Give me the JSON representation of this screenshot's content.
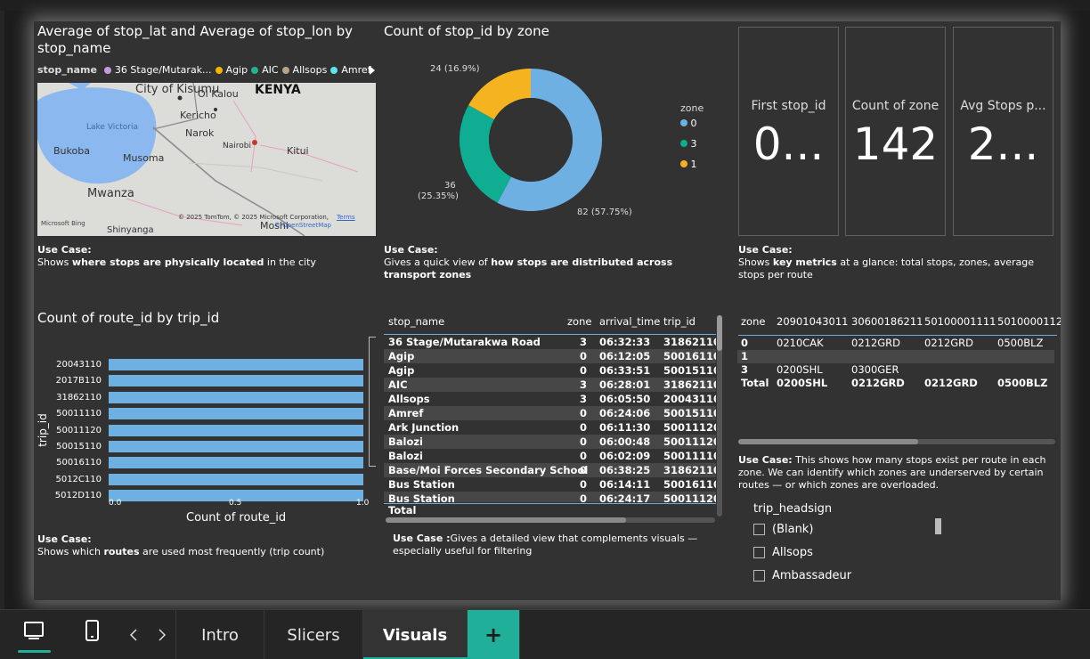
{
  "map_visual": {
    "title": "Average of stop_lat and Average of stop_lon by stop_name",
    "legend_label": "stop_name",
    "legend_items": [
      {
        "label": "36 Stage/Mutarak...",
        "color": "#c49bdc"
      },
      {
        "label": "Agip",
        "color": "#f5b400"
      },
      {
        "label": "AIC",
        "color": "#20b38f"
      },
      {
        "label": "Allsops",
        "color": "#b7a38a"
      },
      {
        "label": "Amref",
        "color": "#5ee6f0"
      }
    ],
    "places": [
      "City of Kisumu",
      "Ol Kalou",
      "KENYA",
      "Kericho",
      "Lake Victoria",
      "Narok",
      "Nairobi",
      "Kitui",
      "Bukoba",
      "Musoma",
      "Mwanza",
      "Shinyanga",
      "Moshi"
    ],
    "attribution": "© 2025 TomTom, © 2025 Microsoft Corporation,",
    "terms": "Terms",
    "osm": "© OpenStreetMap",
    "bing": "Microsoft Bing",
    "use_case_label": "Use Case:",
    "use_case_pre": "Shows ",
    "use_case_bold": "where stops are physically located",
    "use_case_post": " in the city"
  },
  "donut_visual": {
    "title": "Count of stop_id by zone",
    "use_case_label": "Use Case:",
    "use_case_pre": "Gives a quick view of ",
    "use_case_bold": "how stops are distributed across transport zones",
    "slice_labels": {
      "s0": "82 (57.75%)",
      "s3_count": "36",
      "s3_pct": "(25.35%)",
      "s1": "24 (16.9%)"
    }
  },
  "chart_data": [
    {
      "type": "pie",
      "title": "Count of stop_id by zone",
      "legend_title": "zone",
      "legend_position": "right",
      "categories": [
        "0",
        "3",
        "1"
      ],
      "values": [
        82,
        36,
        24
      ],
      "percentages": [
        57.75,
        25.35,
        16.9
      ],
      "colors": [
        "#6fb0e3",
        "#0fad91",
        "#f5b41f"
      ]
    },
    {
      "type": "bar",
      "orientation": "horizontal",
      "title": "Count of route_id by trip_id",
      "xlabel": "Count of route_id",
      "ylabel": "trip_id",
      "categories": [
        "20043110",
        "2017B110",
        "31862110",
        "50011110",
        "50011120",
        "50015110",
        "50016110",
        "5012C110",
        "5012D110"
      ],
      "values": [
        1,
        1,
        1,
        1,
        1,
        1,
        1,
        1,
        1
      ],
      "xlim": [
        0,
        1
      ],
      "xticks": [
        "0.0",
        "0.5",
        "1.0"
      ],
      "color": "#6fb0e3"
    }
  ],
  "bar_visual": {
    "use_case_label": "Use Case:",
    "use_case_pre": "Shows which ",
    "use_case_bold": "routes",
    "use_case_post": " are used most frequently (trip count)"
  },
  "cards": [
    {
      "title": "First stop_id",
      "value": "0..."
    },
    {
      "title": "Count of zone",
      "value": "142"
    },
    {
      "title": "Avg Stops p...",
      "value": "2..."
    }
  ],
  "cards_use_case": {
    "label": "Use Case:",
    "pre": "Shows ",
    "bold": "key metrics",
    "post": " at a glance: total stops, zones, average stops per route"
  },
  "table": {
    "headers": [
      "stop_name",
      "zone",
      "arrival_time",
      "trip_id"
    ],
    "rows": [
      [
        "36 Stage/Mutarakwa Road",
        "3",
        "06:32:33",
        "31862110"
      ],
      [
        "Agip",
        "0",
        "06:12:05",
        "50016110"
      ],
      [
        "Agip",
        "0",
        "06:33:51",
        "50015110"
      ],
      [
        "AIC",
        "3",
        "06:28:01",
        "31862110"
      ],
      [
        "Allsops",
        "3",
        "06:05:50",
        "20043110"
      ],
      [
        "Amref",
        "0",
        "06:24:06",
        "50015110"
      ],
      [
        "Ark Junction",
        "0",
        "06:11:30",
        "50011120"
      ],
      [
        "Balozi",
        "0",
        "06:00:48",
        "50011120"
      ],
      [
        "Balozi",
        "0",
        "06:02:09",
        "50011110"
      ],
      [
        "Base/Moi Forces Secondary School",
        "0",
        "06:38:25",
        "31862110"
      ],
      [
        "Bus Station",
        "0",
        "06:14:11",
        "50016110"
      ],
      [
        "Bus Station",
        "0",
        "06:24:17",
        "50011120"
      ]
    ],
    "total_label": "Total",
    "use_case_label": "Use Case :",
    "use_case_text": "Gives a detailed view that complements visuals — especially useful for filtering"
  },
  "matrix": {
    "headers": [
      "zone",
      "20901043011",
      "30600186211",
      "50100001111",
      "5010000112"
    ],
    "rows": [
      [
        "0",
        "0210CAK",
        "0212GRD",
        "0212GRD",
        "0500BLZ"
      ],
      [
        "1",
        "",
        "",
        "",
        ""
      ],
      [
        "3",
        "0200SHL",
        "0300GER",
        "",
        ""
      ],
      [
        "Total",
        "0200SHL",
        "0212GRD",
        "0212GRD",
        "0500BLZ"
      ]
    ],
    "use_case_label": "Use Case:",
    "use_case_text": "This shows how many stops exist per route in each zone. We can identify which zones are underserved by certain routes — or which zones are overloaded."
  },
  "slicer": {
    "title": "trip_headsign",
    "options": [
      "(Blank)",
      "Allsops",
      "Ambassadeur"
    ]
  },
  "bottom_bar": {
    "tabs": [
      "Intro",
      "Slicers",
      "Visuals"
    ],
    "active_tab": "Visuals",
    "add_label": "+"
  }
}
